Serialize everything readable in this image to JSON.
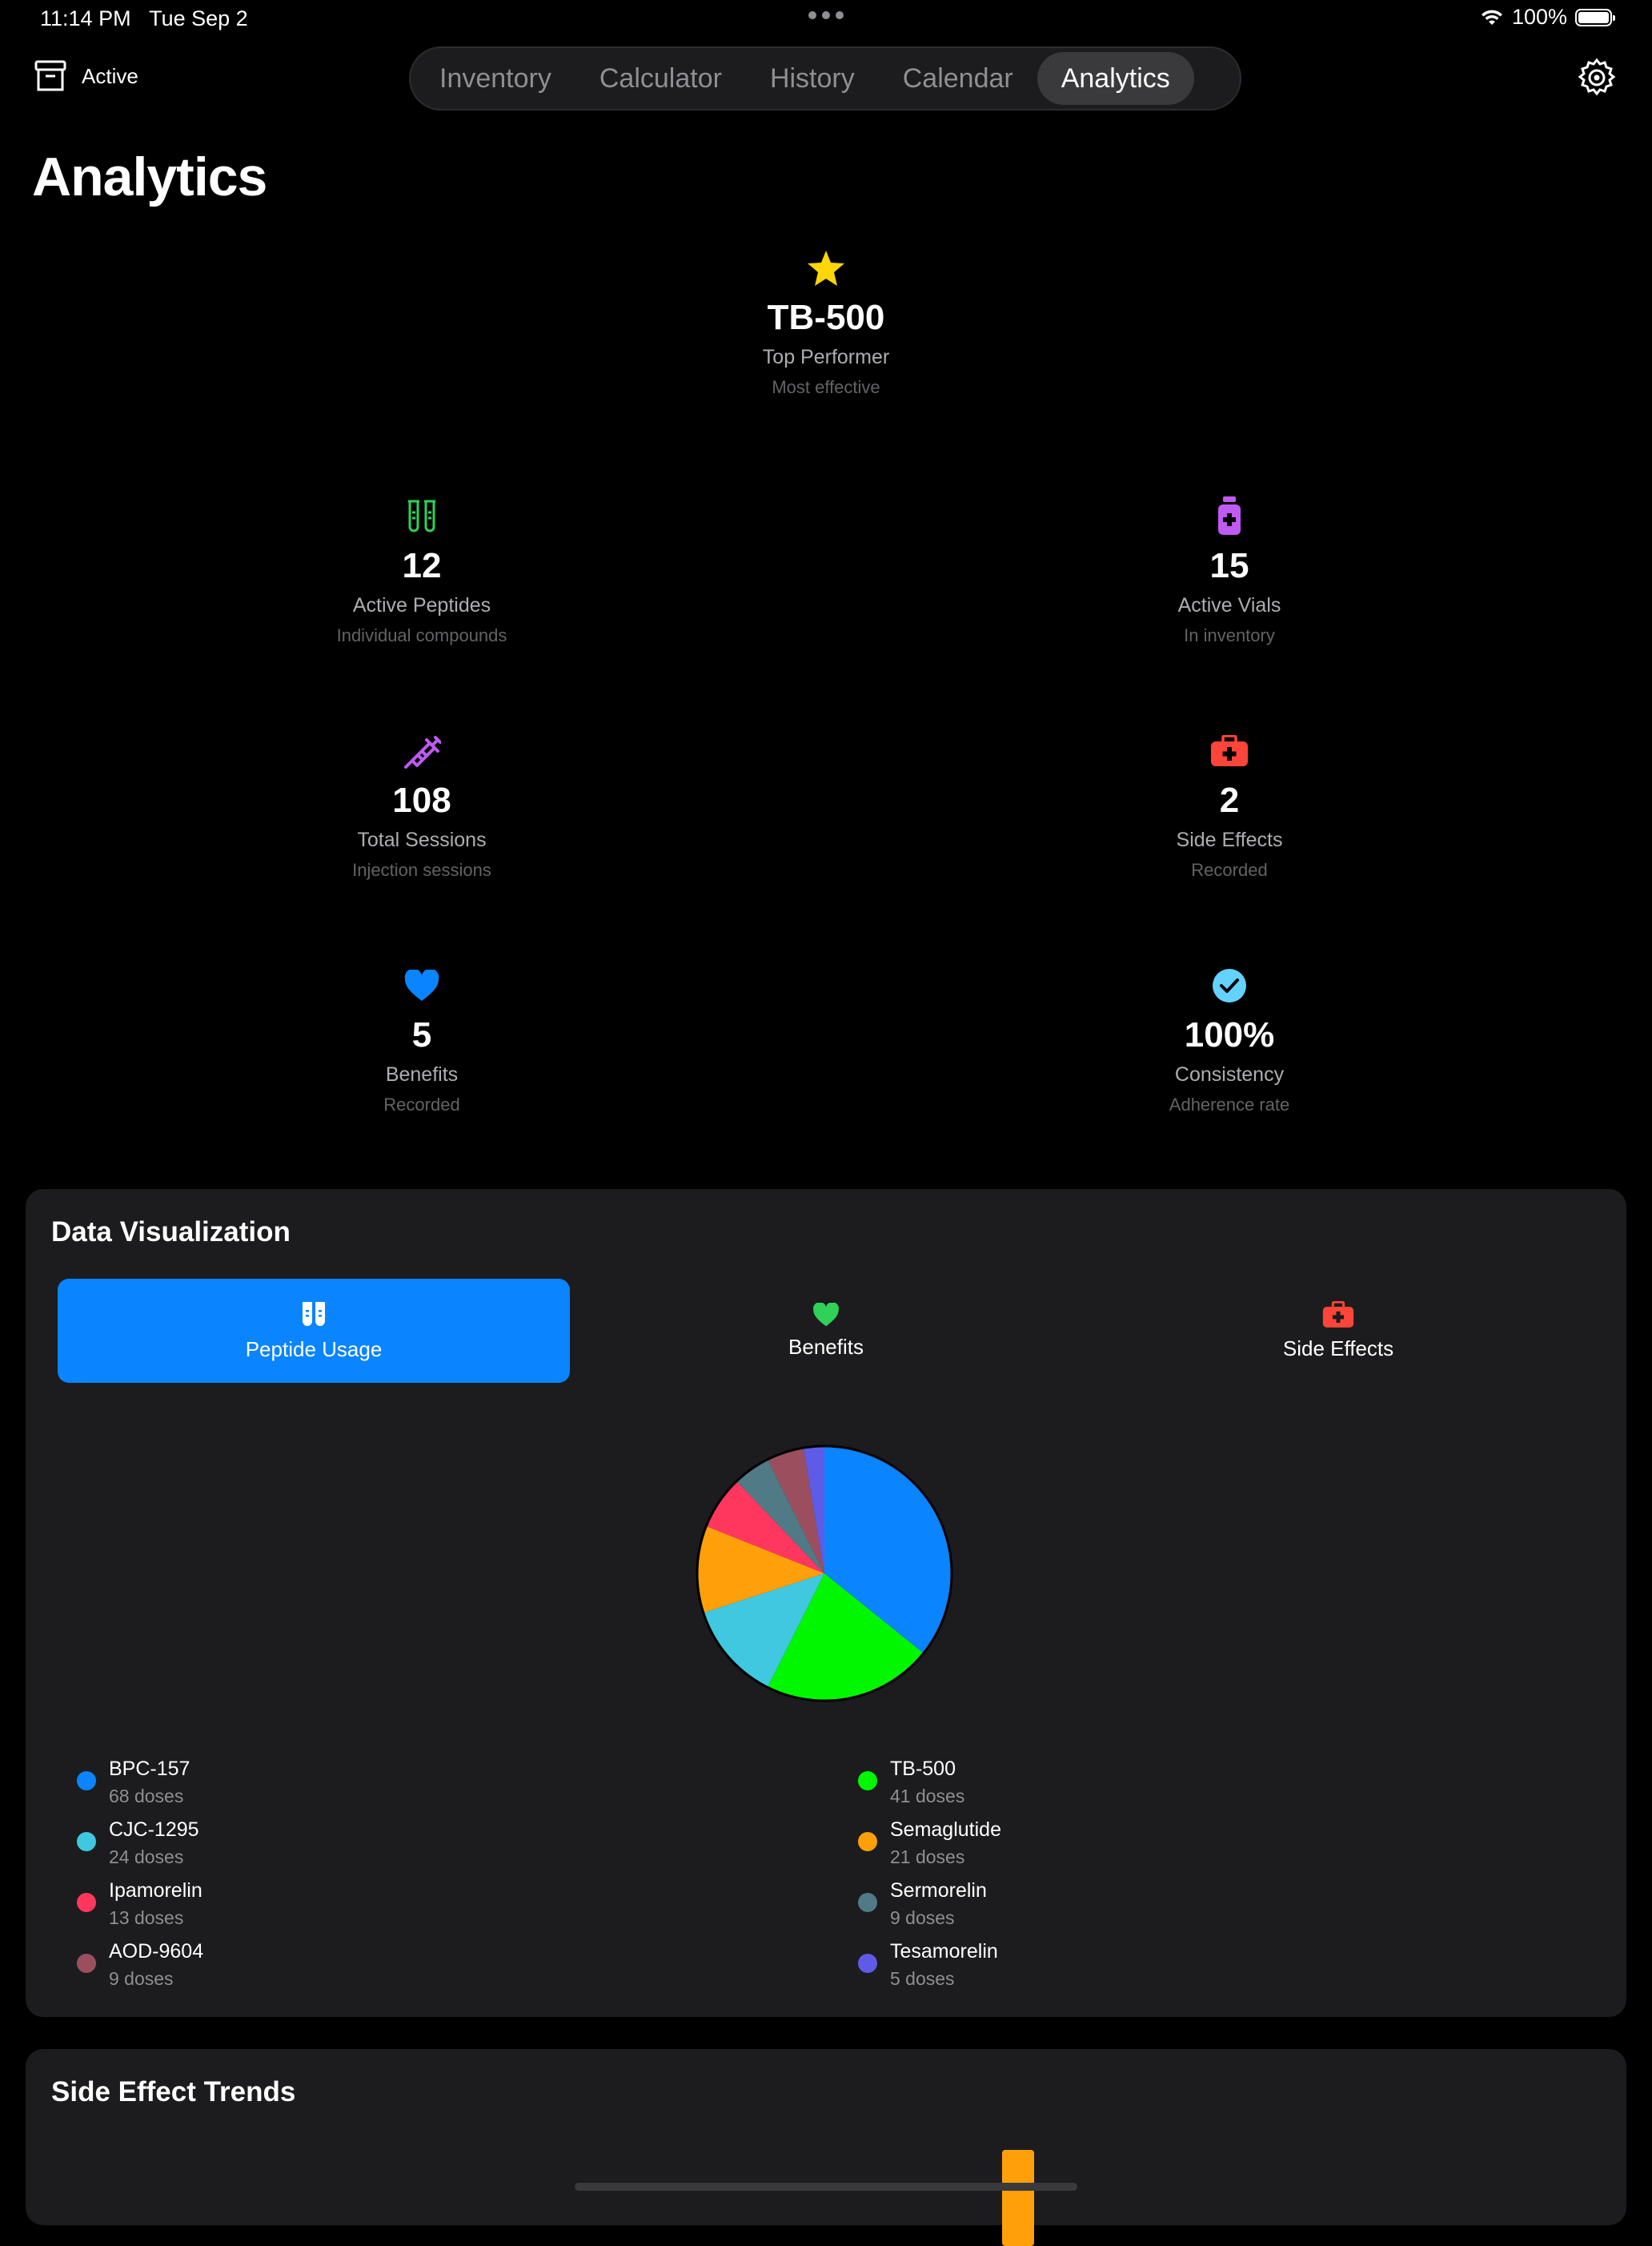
{
  "status": {
    "time": "11:14 PM",
    "date": "Tue Sep 2",
    "battery": "100%"
  },
  "header": {
    "active_label": "Active",
    "tabs": [
      "Inventory",
      "Calculator",
      "History",
      "Calendar",
      "Analytics"
    ],
    "selected_tab": "Analytics"
  },
  "page": {
    "title": "Analytics"
  },
  "top_performer": {
    "name": "TB-500",
    "label": "Top Performer",
    "sub": "Most effective"
  },
  "stats": {
    "active_peptides": {
      "value": "12",
      "label": "Active Peptides",
      "sub": "Individual compounds"
    },
    "active_vials": {
      "value": "15",
      "label": "Active Vials",
      "sub": "In inventory"
    },
    "total_sessions": {
      "value": "108",
      "label": "Total Sessions",
      "sub": "Injection sessions"
    },
    "side_effects": {
      "value": "2",
      "label": "Side Effects",
      "sub": "Recorded"
    },
    "benefits": {
      "value": "5",
      "label": "Benefits",
      "sub": "Recorded"
    },
    "consistency": {
      "value": "100%",
      "label": "Consistency",
      "sub": "Adherence rate"
    }
  },
  "data_viz": {
    "title": "Data Visualization",
    "tabs": [
      "Peptide Usage",
      "Benefits",
      "Side Effects"
    ],
    "selected_tab": "Peptide Usage"
  },
  "colors": {
    "BPC-157": "#0a84ff",
    "TB-500": "#00f700",
    "CJC-1295": "#40c8e0",
    "Semaglutide": "#ff9f0a",
    "Ipamorelin": "#ff375f",
    "Sermorelin": "#4f7a86",
    "AOD-9604": "#9b4f5e",
    "Tesamorelin": "#5e5ce6",
    "green_icon": "#30d158",
    "purple_icon": "#bf5af2",
    "red_icon": "#ff453a",
    "blue_icon": "#0a84ff",
    "teal_icon": "#64d2ff",
    "star": "#ffd60a"
  },
  "chart_data": {
    "type": "pie",
    "categories": [
      "BPC-157",
      "TB-500",
      "CJC-1295",
      "Semaglutide",
      "Ipamorelin",
      "Sermorelin",
      "AOD-9604",
      "Tesamorelin"
    ],
    "values": [
      68,
      41,
      24,
      21,
      13,
      9,
      9,
      5
    ],
    "value_labels": [
      "68 doses",
      "41 doses",
      "24 doses",
      "21 doses",
      "13 doses",
      "9 doses",
      "9 doses",
      "5 doses"
    ]
  },
  "side_effect_trends": {
    "title": "Side Effect Trends"
  }
}
